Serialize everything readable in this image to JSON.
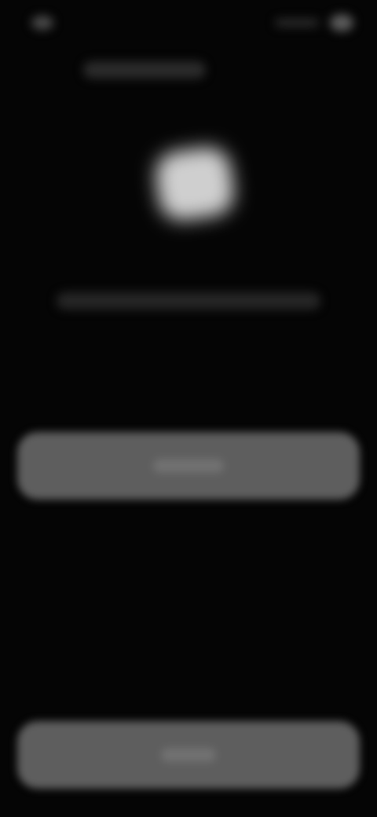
{
  "status_bar": {
    "time": "",
    "signal_icon": "signal-icon",
    "battery_icon": "battery-icon"
  },
  "header": {
    "title": ""
  },
  "logo": {
    "icon": "app-logo-icon",
    "color": "#cfcfcf"
  },
  "description": {
    "text": ""
  },
  "primary_button": {
    "label": "",
    "color": "#5e5e5e"
  },
  "secondary_button": {
    "label": "",
    "color": "#5e5e5e"
  },
  "colors": {
    "background": "#050505"
  }
}
